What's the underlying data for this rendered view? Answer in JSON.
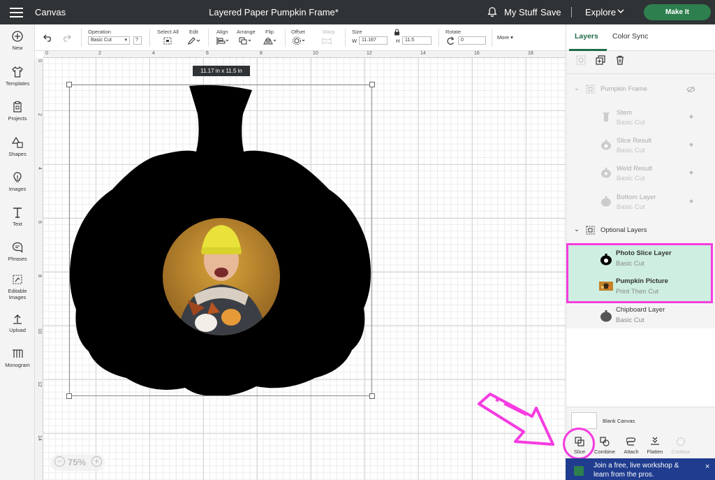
{
  "topbar": {
    "app_title": "Canvas",
    "doc_title": "Layered Paper Pumpkin Frame*",
    "my_stuff": "My Stuff",
    "save": "Save",
    "explore": "Explore",
    "make_it": "Make It"
  },
  "sidebar": {
    "items": [
      {
        "label": "New",
        "icon": "plus-circle-icon"
      },
      {
        "label": "Templates",
        "icon": "shirt-icon"
      },
      {
        "label": "Projects",
        "icon": "projects-icon"
      },
      {
        "label": "Shapes",
        "icon": "shapes-icon"
      },
      {
        "label": "Images",
        "icon": "lightbulb-icon"
      },
      {
        "label": "Text",
        "icon": "text-icon"
      },
      {
        "label": "Phrases",
        "icon": "speech-bubble-icon"
      },
      {
        "label": "Editable Images",
        "icon": "editable-image-icon"
      },
      {
        "label": "Upload",
        "icon": "upload-icon"
      },
      {
        "label": "Monogram",
        "icon": "monogram-icon"
      }
    ]
  },
  "toolbar": {
    "operation_label": "Operation",
    "operation_value": "Basic Cut",
    "help": "?",
    "select_all": "Select All",
    "edit": "Edit",
    "align": "Align",
    "arrange": "Arrange",
    "flip": "Flip",
    "offset": "Offset",
    "warp": "Warp",
    "size": "Size",
    "w_label": "W",
    "w_value": "11.167",
    "h_label": "H",
    "h_value": "11.5",
    "rotate": "Rotate",
    "rotate_value": "0",
    "more": "More"
  },
  "ruler": {
    "top": [
      "0",
      "2",
      "4",
      "6",
      "8",
      "10",
      "12",
      "14",
      "16",
      "18"
    ],
    "left": [
      "0",
      "2",
      "4",
      "6",
      "8",
      "10",
      "12",
      "14"
    ]
  },
  "canvas": {
    "dimension_tip": "11.17  in x 11.5  in",
    "zoom": "75%"
  },
  "layers_panel": {
    "tab_layers": "Layers",
    "tab_color_sync": "Color Sync",
    "groups": [
      {
        "name": "Pumpkin Frame",
        "layers": [
          {
            "name": "Stem",
            "op": "Basic Cut"
          },
          {
            "name": "Slice Result",
            "op": "Basic Cut"
          },
          {
            "name": "Weld Result",
            "op": "Basic Cut"
          },
          {
            "name": "Bottom Layer",
            "op": "Basic Cut"
          }
        ]
      },
      {
        "name": "Optional Layers",
        "layers": [
          {
            "name": "Photo Slice Layer",
            "op": "Basic Cut"
          },
          {
            "name": "Pumpkin Picture",
            "op": "Print Then Cut"
          },
          {
            "name": "Chipboard Layer",
            "op": "Basic Cut"
          }
        ]
      }
    ],
    "blank_canvas": "Blank Canvas",
    "bottom_tools": [
      "Slice",
      "Combine",
      "Attach",
      "Flatten",
      "Contour"
    ],
    "promo": "Join a free, live workshop & learn from the pros."
  },
  "colors": {
    "topbar": "#2f3336",
    "make_it": "#2d7f4d",
    "highlight": "#f63ce0",
    "selected_row": "#cdeee0"
  }
}
